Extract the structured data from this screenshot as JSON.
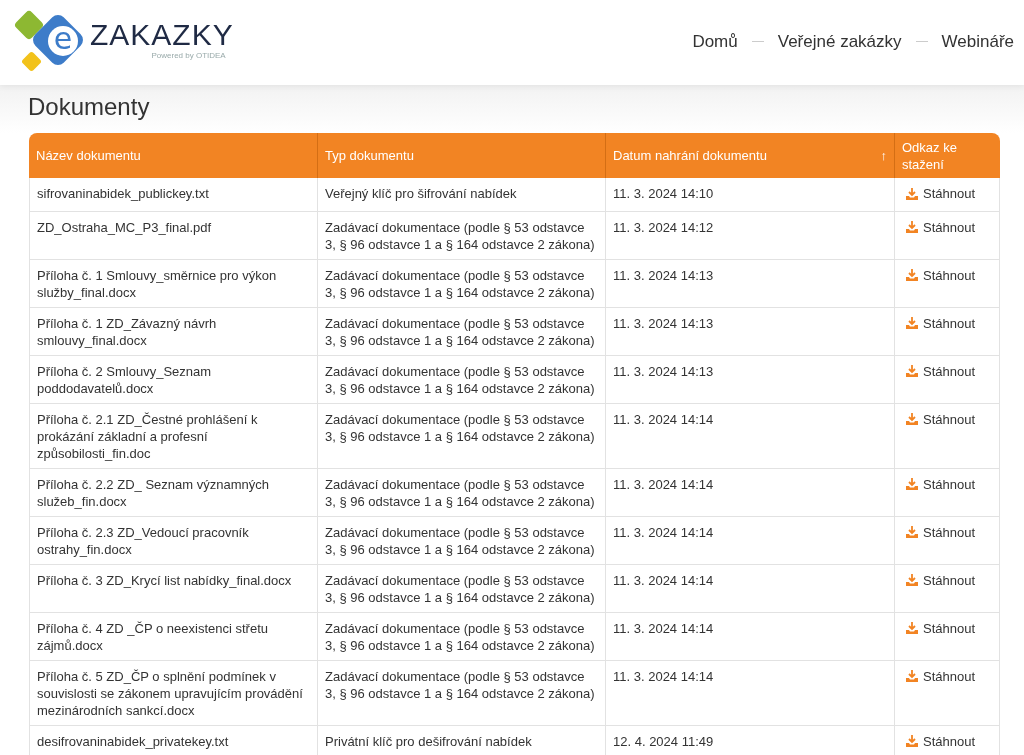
{
  "logo": {
    "mark": "e",
    "name": "ZAKAZKY",
    "tagline": "Powered by OTIDEA"
  },
  "nav": [
    {
      "label": "Domů"
    },
    {
      "label": "Veřejné zakázky"
    },
    {
      "label": "Webináře"
    }
  ],
  "page_title": "Dokumenty",
  "table": {
    "columns": [
      {
        "label": "Název dokumentu"
      },
      {
        "label": "Typ dokumentu"
      },
      {
        "label": "Datum nahrání dokumentu",
        "sort_arrow": "↑"
      },
      {
        "label": "Odkaz ke stažení"
      }
    ],
    "rows": [
      {
        "name": "sifrovaninabidek_publickey.txt",
        "type": "Veřejný klíč pro šifrování nabídek",
        "date": "11. 3. 2024 14:10",
        "link": "Stáhnout"
      },
      {
        "name": "ZD_Ostraha_MC_P3_final.pdf",
        "type": "Zadávací dokumentace (podle § 53 odstavce 3, § 96 odstavce 1 a § 164 odstavce 2 zákona)",
        "date": "11. 3. 2024 14:12",
        "link": "Stáhnout"
      },
      {
        "name": "Příloha č. 1 Smlouvy_směrnice pro výkon služby_final.docx",
        "type": "Zadávací dokumentace (podle § 53 odstavce 3, § 96 odstavce 1 a § 164 odstavce 2 zákona)",
        "date": "11. 3. 2024 14:13",
        "link": "Stáhnout"
      },
      {
        "name": "Příloha č. 1 ZD_Závazný návrh smlouvy_final.docx",
        "type": "Zadávací dokumentace (podle § 53 odstavce 3, § 96 odstavce 1 a § 164 odstavce 2 zákona)",
        "date": "11. 3. 2024 14:13",
        "link": "Stáhnout"
      },
      {
        "name": "Příloha č. 2 Smlouvy_Seznam poddodavatelů.docx",
        "type": "Zadávací dokumentace (podle § 53 odstavce 3, § 96 odstavce 1 a § 164 odstavce 2 zákona)",
        "date": "11. 3. 2024 14:13",
        "link": "Stáhnout"
      },
      {
        "name": "Příloha č. 2.1 ZD_Čestné prohlášení k prokázání základní a profesní způsobilosti_fin.doc",
        "type": "Zadávací dokumentace (podle § 53 odstavce 3, § 96 odstavce 1 a § 164 odstavce 2 zákona)",
        "date": "11. 3. 2024 14:14",
        "link": "Stáhnout"
      },
      {
        "name": "Příloha č. 2.2 ZD_ Seznam významných služeb_fin.docx",
        "type": "Zadávací dokumentace (podle § 53 odstavce 3, § 96 odstavce 1 a § 164 odstavce 2 zákona)",
        "date": "11. 3. 2024 14:14",
        "link": "Stáhnout"
      },
      {
        "name": "Příloha č. 2.3 ZD_Vedoucí pracovník ostrahy_fin.docx",
        "type": "Zadávací dokumentace (podle § 53 odstavce 3, § 96 odstavce 1 a § 164 odstavce 2 zákona)",
        "date": "11. 3. 2024 14:14",
        "link": "Stáhnout"
      },
      {
        "name": "Příloha č. 3 ZD_Krycí list nabídky_final.docx",
        "type": "Zadávací dokumentace (podle § 53 odstavce 3, § 96 odstavce 1 a § 164 odstavce 2 zákona)",
        "date": "11. 3. 2024 14:14",
        "link": "Stáhnout"
      },
      {
        "name": "Příloha č. 4 ZD _ČP o neexistenci střetu zájmů.docx",
        "type": "Zadávací dokumentace (podle § 53 odstavce 3, § 96 odstavce 1 a § 164 odstavce 2 zákona)",
        "date": "11. 3. 2024 14:14",
        "link": "Stáhnout"
      },
      {
        "name": "Příloha č. 5 ZD_ČP o splnění podmínek v souvislosti se zákonem upravujícím provádění mezinárodních sankcí.docx",
        "type": "Zadávací dokumentace (podle § 53 odstavce 3, § 96 odstavce 1 a § 164 odstavce 2 zákona)",
        "date": "11. 3. 2024 14:14",
        "link": "Stáhnout"
      },
      {
        "name": "desifrovaninabidek_privatekey.txt",
        "type": "Privátní klíč pro dešifrování nabídek",
        "date": "12. 4. 2024 11:49",
        "link": "Stáhnout"
      }
    ]
  }
}
